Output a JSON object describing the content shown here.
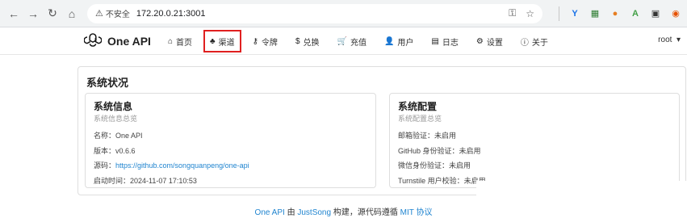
{
  "browser": {
    "security_label": "不安全",
    "url": "172.20.0.21:3001"
  },
  "header": {
    "brand": "One API",
    "menu": [
      {
        "label": "首页",
        "icon": "home-icon"
      },
      {
        "label": "渠道",
        "icon": "sitemap-icon",
        "active": true
      },
      {
        "label": "令牌",
        "icon": "key-icon"
      },
      {
        "label": "兑换",
        "icon": "dollar-icon"
      },
      {
        "label": "充值",
        "icon": "cart-icon"
      },
      {
        "label": "用户",
        "icon": "user-icon"
      },
      {
        "label": "日志",
        "icon": "book-icon"
      },
      {
        "label": "设置",
        "icon": "gear-icon"
      },
      {
        "label": "关于",
        "icon": "info-icon"
      }
    ],
    "user": "root"
  },
  "main": {
    "title": "系统状况",
    "system_info": {
      "title": "系统信息",
      "subtitle": "系统信息总览",
      "name": "名称：One API",
      "version": "版本：v0.6.6",
      "source_label": "源码：",
      "source_link": "https://github.com/songquanpeng/one-api",
      "start_time": "启动时间：2024-11-07 17:10:53"
    },
    "system_config": {
      "title": "系统配置",
      "subtitle": "系统配置总览",
      "email_verify": "邮箱验证：未启用",
      "github_auth": "GitHub 身份验证：未启用",
      "wechat_auth": "微信身份验证：未启用",
      "turnstile": "Turnstile 用户校验：未启用"
    }
  },
  "footer": {
    "app_link": "One API",
    "by": " 由 ",
    "author_link": "JustSong",
    "middle": " 构建，源代码遵循 ",
    "license_link": "MIT 协议"
  },
  "colors": {
    "accent": "#2185d0",
    "active_outline": "#e02020"
  }
}
